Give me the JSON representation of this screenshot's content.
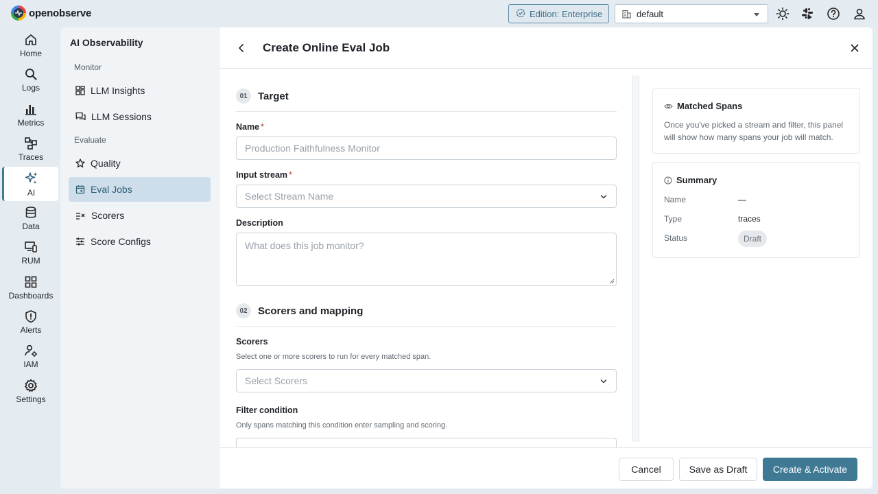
{
  "app": {
    "name": "openobserve"
  },
  "topbar": {
    "edition": "Edition: Enterprise",
    "org": "default"
  },
  "nav": [
    {
      "label": "Home",
      "icon": "home-icon"
    },
    {
      "label": "Logs",
      "icon": "search-icon"
    },
    {
      "label": "Metrics",
      "icon": "bar-chart-icon"
    },
    {
      "label": "Traces",
      "icon": "traces-icon"
    },
    {
      "label": "AI",
      "icon": "sparkle-icon",
      "active": true
    },
    {
      "label": "Data",
      "icon": "database-icon"
    },
    {
      "label": "RUM",
      "icon": "devices-icon"
    },
    {
      "label": "Dashboards",
      "icon": "dashboard-icon"
    },
    {
      "label": "Alerts",
      "icon": "shield-alert-icon"
    },
    {
      "label": "IAM",
      "icon": "user-gear-icon"
    },
    {
      "label": "Settings",
      "icon": "gear-icon"
    }
  ],
  "subnav": {
    "title": "AI Observability",
    "group_monitor": "Monitor",
    "group_evaluate": "Evaluate",
    "items": [
      {
        "label": "LLM Insights",
        "icon": "grid-icon"
      },
      {
        "label": "LLM Sessions",
        "icon": "chat-icon"
      },
      {
        "label": "Quality",
        "icon": "star-icon"
      },
      {
        "label": "Eval Jobs",
        "icon": "calendar-icon",
        "active": true
      },
      {
        "label": "Scorers",
        "icon": "list-check-icon"
      },
      {
        "label": "Score Configs",
        "icon": "sliders-icon"
      }
    ]
  },
  "page": {
    "title": "Create Online Eval Job"
  },
  "form": {
    "step1_num": "01",
    "step1_title": "Target",
    "name_label": "Name",
    "name_placeholder": "Production Faithfulness Monitor",
    "stream_label": "Input stream",
    "stream_placeholder": "Select Stream Name",
    "description_label": "Description",
    "description_placeholder": "What does this job monitor?",
    "step2_num": "02",
    "step2_title": "Scorers and mapping",
    "scorers_label": "Scorers",
    "scorers_hint": "Select one or more scorers to run for every matched span.",
    "scorers_placeholder": "Select Scorers",
    "filter_label": "Filter condition",
    "filter_hint": "Only spans matching this condition enter sampling and scoring.",
    "required_mark": "*"
  },
  "matched": {
    "title": "Matched Spans",
    "text": "Once you've picked a stream and filter, this panel will show how many spans your job will match."
  },
  "summary": {
    "title": "Summary",
    "name_key": "Name",
    "name_val": "—",
    "type_key": "Type",
    "type_val": "traces",
    "status_key": "Status",
    "status_val": "Draft"
  },
  "footer": {
    "cancel": "Cancel",
    "save_draft": "Save as Draft",
    "create": "Create & Activate"
  },
  "colors": {
    "accent": "#3f7994",
    "background": "#e4ebf1",
    "active_item": "#cddde9"
  }
}
